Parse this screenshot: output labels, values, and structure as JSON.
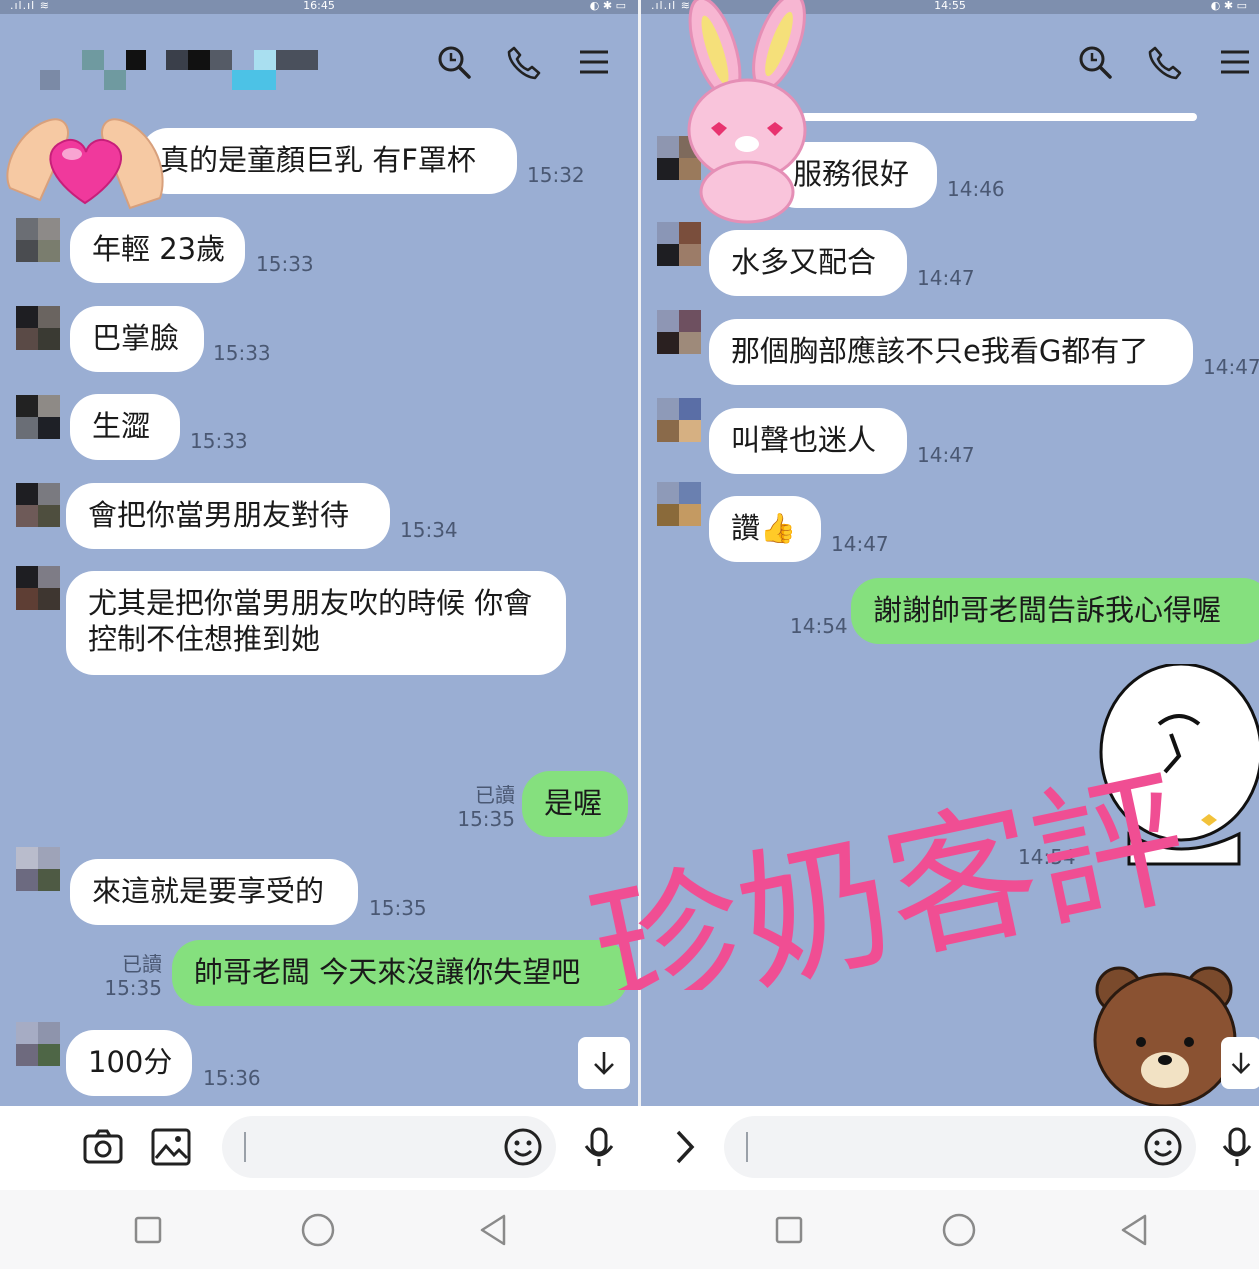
{
  "left_screen": {
    "status_time": "16:45",
    "messages": [
      {
        "text": "真的是童顏巨乳 有F罩杯",
        "time": "15:32"
      },
      {
        "text": "年輕 23歲",
        "time": "15:33"
      },
      {
        "text": "巴掌臉",
        "time": "15:33"
      },
      {
        "text": "生澀",
        "time": "15:33"
      },
      {
        "text": "會把你當男朋友對待",
        "time": "15:34"
      },
      {
        "text": "尤其是把你當男朋友吹的時候 你會控制不住想推到她",
        "time": ""
      },
      {
        "text": "是喔",
        "time": "15:35",
        "read": "已讀"
      },
      {
        "text": "來這就是要享受的",
        "time": "15:35"
      },
      {
        "text": "帥哥老闆 今天來沒讓你失望吧",
        "time": "15:35",
        "read": "已讀"
      },
      {
        "text": "100分",
        "time": "15:36"
      }
    ]
  },
  "right_screen": {
    "status_time": "14:55",
    "messages": [
      {
        "text": "服務很好",
        "time": "14:46"
      },
      {
        "text": "水多又配合",
        "time": "14:47"
      },
      {
        "text": "那個胸部應該不只e我看G都有了",
        "time": "14:47"
      },
      {
        "text": "叫聲也迷人",
        "time": "14:47"
      },
      {
        "text": "讚👍",
        "time": "14:47"
      },
      {
        "text": "謝謝帥哥老闆告訴我心得喔",
        "time": "14:54"
      },
      {
        "text": "",
        "time": "14:54"
      }
    ]
  },
  "icons": {
    "header": [
      "search-icon",
      "phone-icon",
      "menu-icon"
    ],
    "input": [
      "camera-icon",
      "image-icon",
      "emoji-icon",
      "mic-icon",
      "chevron-right-icon"
    ],
    "nav": [
      "recent-apps-icon",
      "home-icon",
      "back-icon"
    ],
    "scroll": "arrow-down-icon"
  },
  "watermark": {
    "text": "珍奶客評"
  },
  "colors": {
    "chat_background": "#9aaed3",
    "incoming_bubble": "#ffffff",
    "outgoing_bubble": "#85e07e",
    "watermark": "#f04e93"
  }
}
